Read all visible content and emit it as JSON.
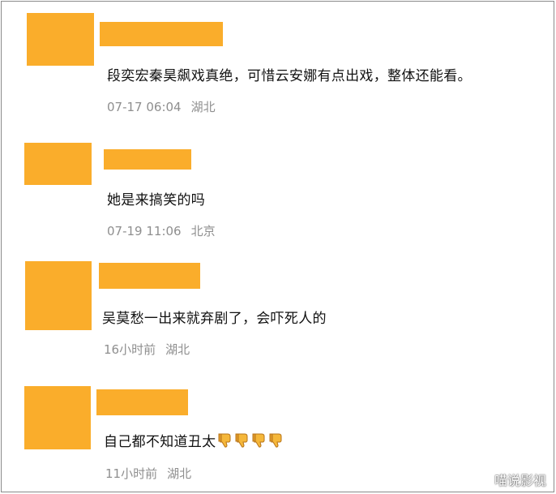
{
  "colors": {
    "placeholder": "#FAAD2B",
    "meta_text": "#8f8f8f",
    "body_text": "#111111"
  },
  "comments": [
    {
      "text": "段奕宏秦昊飙戏真绝，可惜云安娜有点出戏，整体还能看。",
      "time": "07-17 06:04",
      "location": "湖北"
    },
    {
      "text": "她是来搞笑的吗",
      "time": "07-19 11:06",
      "location": "北京"
    },
    {
      "text": "吴莫愁一出来就弃剧了，会吓死人的",
      "time": "16小时前",
      "location": "湖北"
    },
    {
      "text": "自己都不知道丑太",
      "emoji_icons": [
        "thumbs-down-icon",
        "thumbs-down-icon",
        "thumbs-down-icon",
        "thumbs-down-icon"
      ],
      "time": "11小时前",
      "location": "湖北"
    }
  ],
  "watermark": "喵说影视"
}
